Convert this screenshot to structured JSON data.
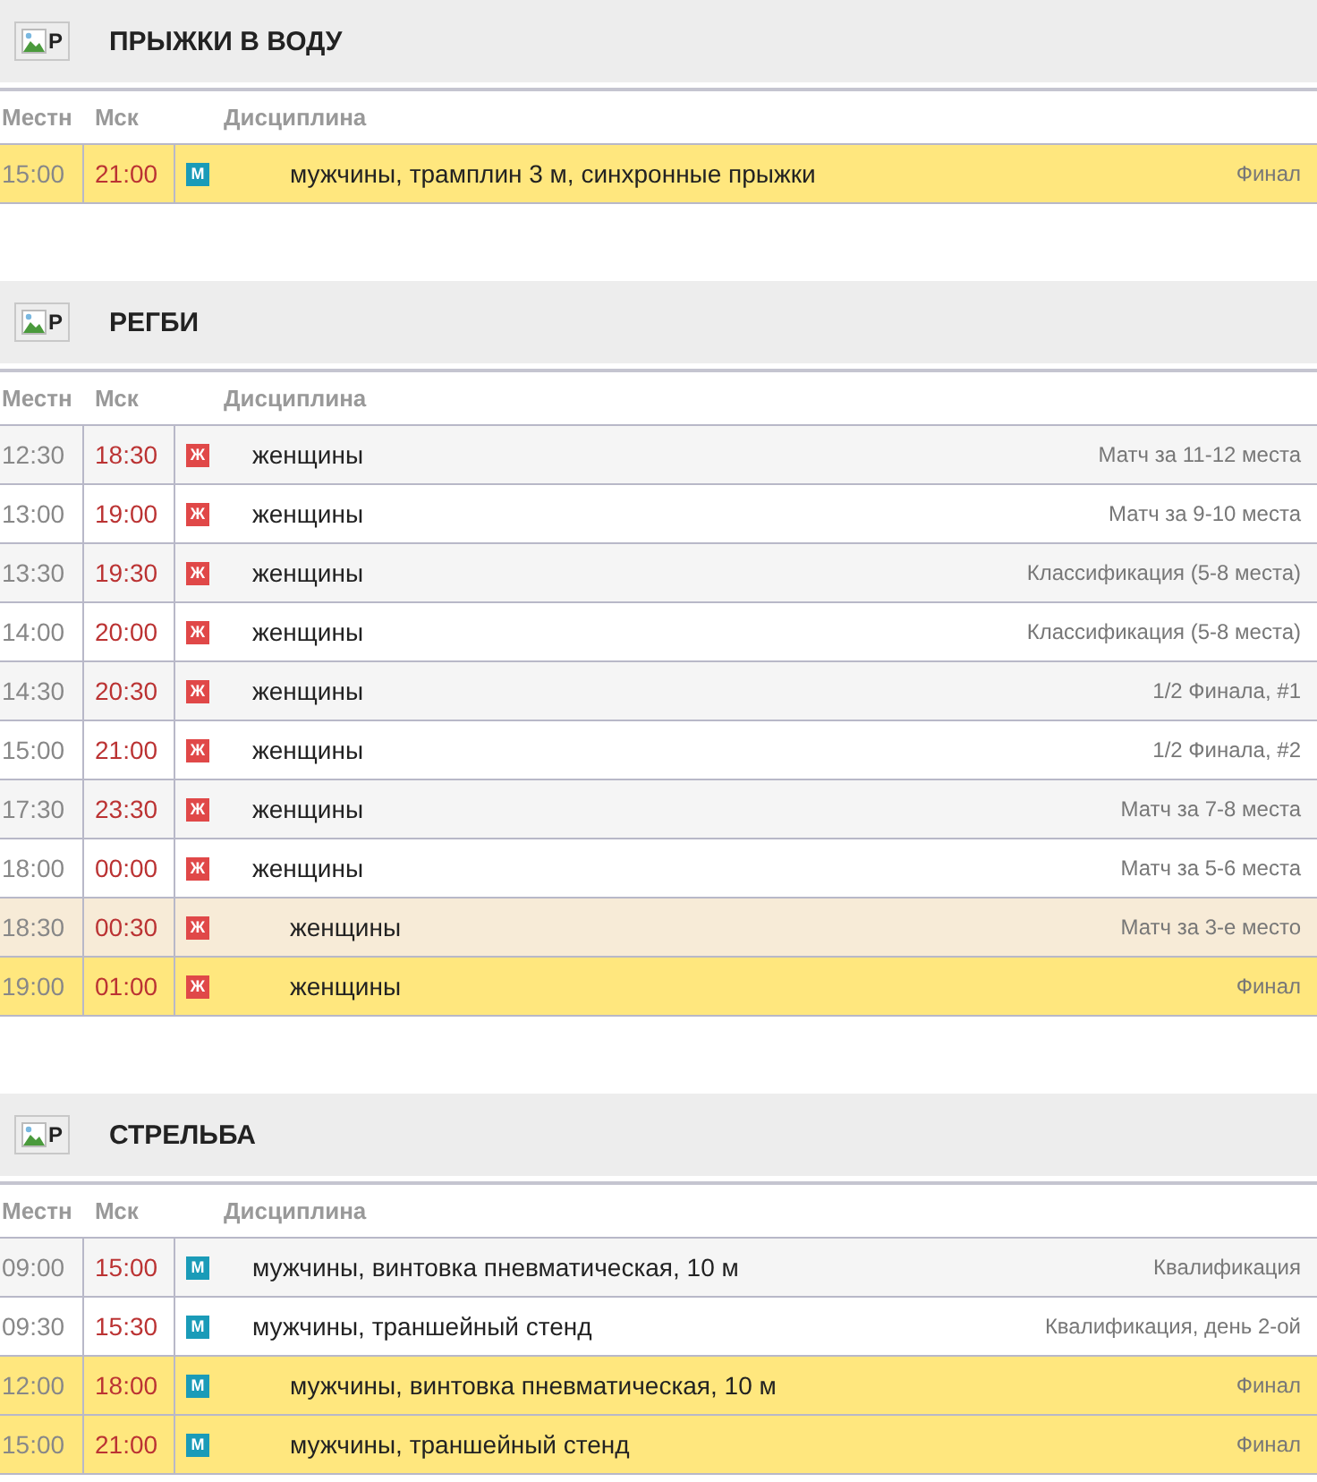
{
  "sections": [
    {
      "icon_alt": "P",
      "title": "ПРЫЖКИ В ВОДУ",
      "columns": [
        "Местн",
        "Мск",
        "Дисциплина"
      ],
      "rows": [
        {
          "kind": "gold",
          "local": "15:00",
          "msk": "21:00",
          "badge": "М",
          "color": "#1a9bb8",
          "discipline": "мужчины, трамплин 3 м, синхронные прыжки",
          "stage": "Финал"
        }
      ]
    },
    {
      "icon_alt": "P",
      "title": "РЕГБИ",
      "columns": [
        "Местн",
        "Мск",
        "Дисциплина"
      ],
      "rows": [
        {
          "kind": "regular",
          "local": "12:30",
          "msk": "18:30",
          "badge": "Ж",
          "color": "#e04848",
          "discipline": "женщины",
          "stage": "Матч за 11-12 места"
        },
        {
          "kind": "regular",
          "local": "13:00",
          "msk": "19:00",
          "badge": "Ж",
          "color": "#e04848",
          "discipline": "женщины",
          "stage": "Матч за 9-10 места"
        },
        {
          "kind": "regular",
          "local": "13:30",
          "msk": "19:30",
          "badge": "Ж",
          "color": "#e04848",
          "discipline": "женщины",
          "stage": "Классификация (5-8 места)"
        },
        {
          "kind": "regular",
          "local": "14:00",
          "msk": "20:00",
          "badge": "Ж",
          "color": "#e04848",
          "discipline": "женщины",
          "stage": "Классификация (5-8 места)"
        },
        {
          "kind": "regular",
          "local": "14:30",
          "msk": "20:30",
          "badge": "Ж",
          "color": "#e04848",
          "discipline": "женщины",
          "stage": "1/2 Финала, #1"
        },
        {
          "kind": "regular",
          "local": "15:00",
          "msk": "21:00",
          "badge": "Ж",
          "color": "#e04848",
          "discipline": "женщины",
          "stage": "1/2 Финала, #2"
        },
        {
          "kind": "regular",
          "local": "17:30",
          "msk": "23:30",
          "badge": "Ж",
          "color": "#e04848",
          "discipline": "женщины",
          "stage": "Матч за 7-8 места"
        },
        {
          "kind": "regular",
          "local": "18:00",
          "msk": "00:00",
          "badge": "Ж",
          "color": "#e04848",
          "discipline": "женщины",
          "stage": "Матч за 5-6 места"
        },
        {
          "kind": "bronze",
          "local": "18:30",
          "msk": "00:30",
          "badge": "Ж",
          "color": "#e04848",
          "discipline": "женщины",
          "stage": "Матч за 3-е место"
        },
        {
          "kind": "gold",
          "local": "19:00",
          "msk": "01:00",
          "badge": "Ж",
          "color": "#e04848",
          "discipline": "женщины",
          "stage": "Финал"
        }
      ]
    },
    {
      "icon_alt": "P",
      "title": "СТРЕЛЬБА",
      "columns": [
        "Местн",
        "Мск",
        "Дисциплина"
      ],
      "rows": [
        {
          "kind": "regular",
          "local": "09:00",
          "msk": "15:00",
          "badge": "М",
          "color": "#1a9bb8",
          "discipline": "мужчины, винтовка пневматическая, 10 м",
          "stage": "Квалификация"
        },
        {
          "kind": "regular",
          "local": "09:30",
          "msk": "15:30",
          "badge": "М",
          "color": "#1a9bb8",
          "discipline": "мужчины, траншейный стенд",
          "stage": "Квалификация, день 2-ой"
        },
        {
          "kind": "gold",
          "local": "12:00",
          "msk": "18:00",
          "badge": "М",
          "color": "#1a9bb8",
          "discipline": "мужчины, винтовка пневматическая, 10 м",
          "stage": "Финал"
        },
        {
          "kind": "gold",
          "local": "15:00",
          "msk": "21:00",
          "badge": "М",
          "color": "#1a9bb8",
          "discipline": "мужчины, траншейный стенд",
          "stage": "Финал"
        }
      ]
    }
  ]
}
